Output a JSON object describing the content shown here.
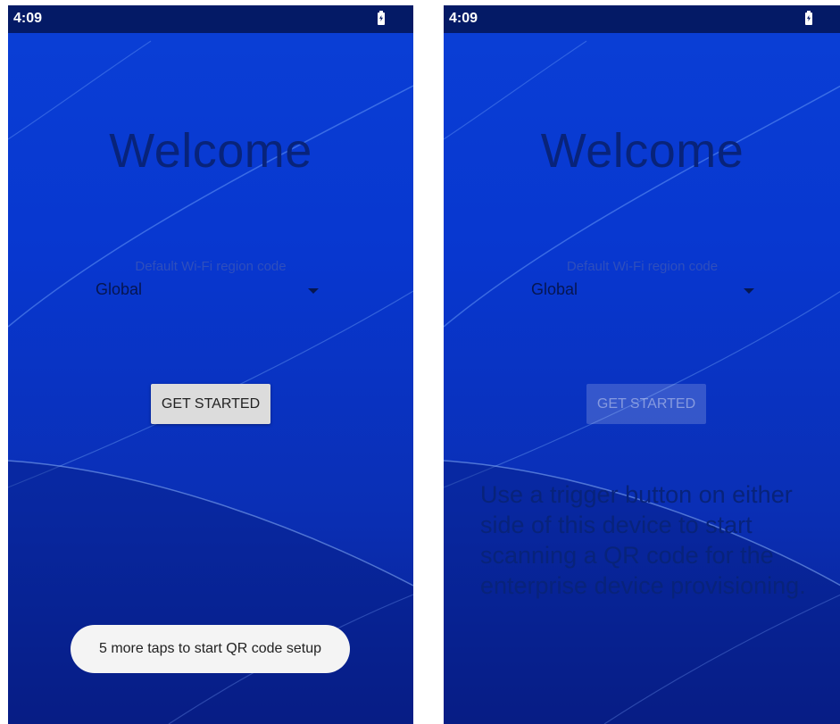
{
  "left_screen": {
    "status_time": "4:09",
    "welcome_title": "Welcome",
    "region_label": "Default Wi-Fi region code",
    "region_value": "Global",
    "get_started_label": "GET STARTED",
    "toast_text": "5 more taps to start QR code setup"
  },
  "right_screen": {
    "status_time": "4:09",
    "welcome_title": "Welcome",
    "region_label": "Default Wi-Fi region code",
    "region_value": "Global",
    "get_started_label": "GET STARTED",
    "instruction_text": "Use a trigger button on either side of this device to start scanning a QR code for the enterprise device provisioning."
  },
  "icons": {
    "battery": "battery-charging-icon",
    "dropdown": "dropdown-arrow-icon"
  },
  "colors": {
    "statusbar_bg": "#041a66",
    "background_blue": "#0a3fd6",
    "button_enabled": "#dcdcdc",
    "toast_bg": "#f4f4f4",
    "title_text": "#08237a"
  }
}
